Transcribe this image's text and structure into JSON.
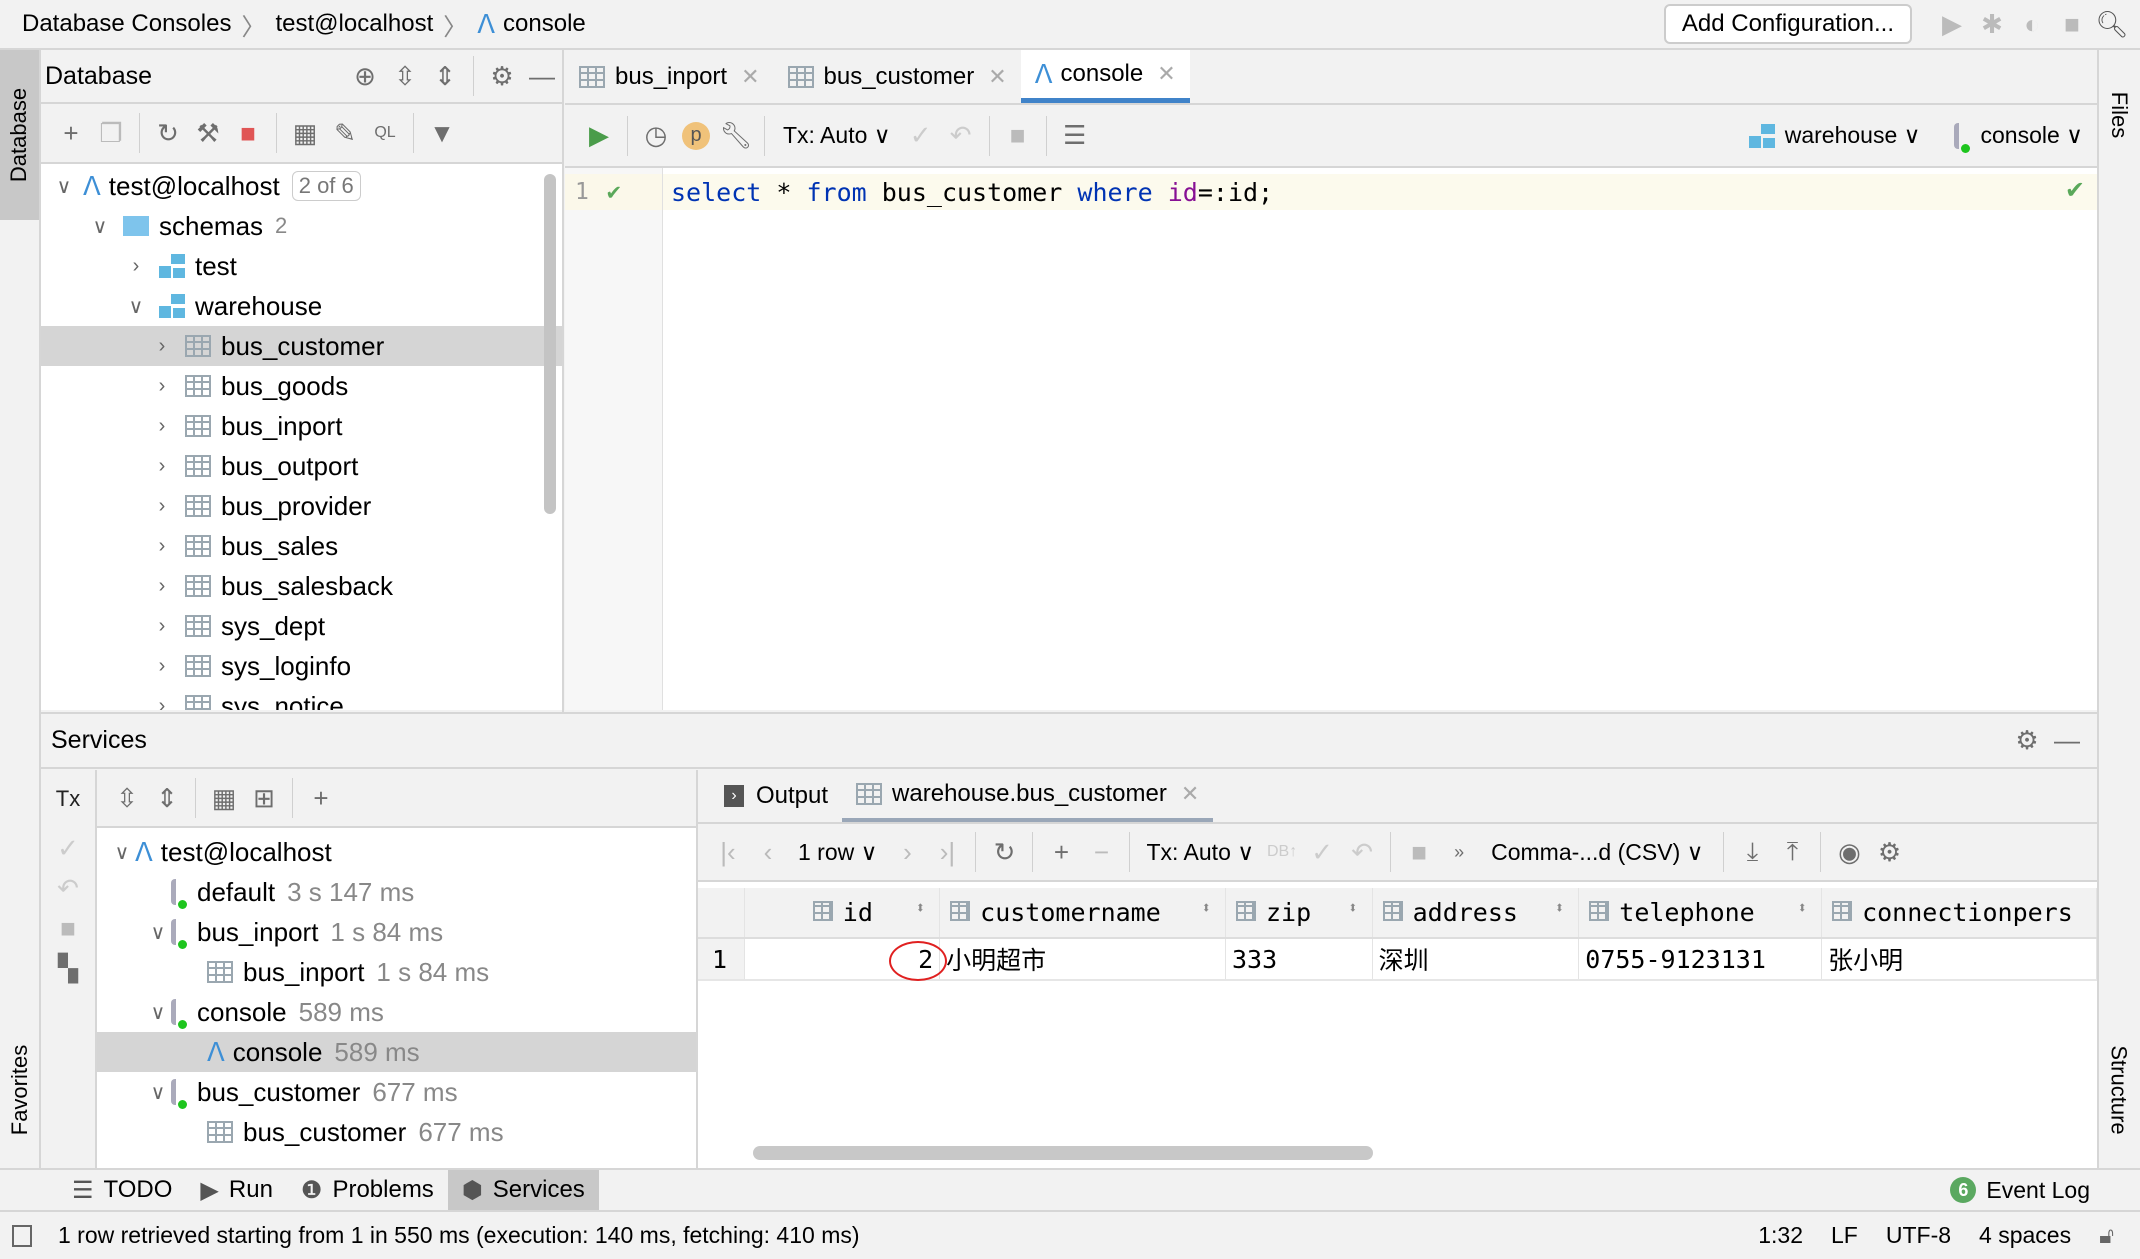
{
  "breadcrumb": [
    "Database Consoles",
    "test@localhost",
    "console"
  ],
  "top": {
    "add_config": "Add Configuration..."
  },
  "left_stripe": {
    "database": "Database",
    "favorites": "Favorites"
  },
  "right_stripe": {
    "files": "Files",
    "structure": "Structure"
  },
  "db_panel": {
    "title": "Database",
    "root": {
      "label": "test@localhost",
      "badge": "2 of 6"
    },
    "schemas": {
      "label": "schemas",
      "count": "2"
    },
    "schema_items": [
      "test",
      "warehouse"
    ],
    "tables": [
      "bus_customer",
      "bus_goods",
      "bus_inport",
      "bus_outport",
      "bus_provider",
      "bus_sales",
      "bus_salesback",
      "sys_dept",
      "sys_loginfo",
      "sys_notice"
    ],
    "selected": "bus_customer"
  },
  "editor": {
    "tabs": [
      {
        "label": "bus_inport"
      },
      {
        "label": "bus_customer"
      },
      {
        "label": "console",
        "active": true
      }
    ],
    "tx": "Tx: Auto",
    "schema": "warehouse",
    "session": "console",
    "line_no": "1",
    "code": [
      {
        "t": "select",
        "c": "kw"
      },
      {
        "t": " * ",
        "c": "pl"
      },
      {
        "t": "from",
        "c": "kw"
      },
      {
        "t": " bus_customer ",
        "c": "pl"
      },
      {
        "t": "where",
        "c": "kw"
      },
      {
        "t": " ",
        "c": "pl"
      },
      {
        "t": "id",
        "c": "col"
      },
      {
        "t": "=:id;",
        "c": "pl"
      }
    ]
  },
  "services": {
    "title": "Services",
    "tx": "Tx",
    "tree": [
      {
        "label": "test@localhost",
        "time": "",
        "level": 0,
        "icon": "mysql",
        "chev": true
      },
      {
        "label": "default",
        "time": "3 s 147 ms",
        "level": 1,
        "icon": "session",
        "chev": false
      },
      {
        "label": "bus_inport",
        "time": "1 s 84 ms",
        "level": 1,
        "icon": "session",
        "chev": true
      },
      {
        "label": "bus_inport",
        "time": "1 s 84 ms",
        "level": 2,
        "icon": "table",
        "chev": false
      },
      {
        "label": "console",
        "time": "589 ms",
        "level": 1,
        "icon": "session",
        "chev": true
      },
      {
        "label": "console",
        "time": "589 ms",
        "level": 2,
        "icon": "mysql",
        "chev": false,
        "selected": true
      },
      {
        "label": "bus_customer",
        "time": "677 ms",
        "level": 1,
        "icon": "session",
        "chev": true
      },
      {
        "label": "bus_customer",
        "time": "677 ms",
        "level": 2,
        "icon": "table",
        "chev": false
      }
    ],
    "tabs": [
      "Output",
      "warehouse.bus_customer"
    ],
    "toolbar": {
      "rows": "1 row",
      "tx": "Tx: Auto",
      "format": "Comma-...d (CSV)"
    },
    "columns": [
      "id",
      "customername",
      "zip",
      "address",
      "telephone",
      "connectionpers"
    ],
    "rows": [
      {
        "n": "1",
        "cells": [
          "2",
          "小明超市",
          "333",
          "深圳",
          "0755-9123131",
          "张小明"
        ]
      }
    ]
  },
  "bottom_tabs": [
    "TODO",
    "Run",
    "Problems",
    "Services"
  ],
  "event_log": {
    "label": "Event Log",
    "count": "6"
  },
  "status": {
    "message": "1 row retrieved starting from 1 in 550 ms (execution: 140 ms, fetching: 410 ms)",
    "pos": "1:32",
    "eol": "LF",
    "enc": "UTF-8",
    "indent": "4 spaces"
  },
  "colors": {
    "accent": "#4083c9",
    "keyword": "#0033b3",
    "column": "#871094",
    "run": "#4a9c4a",
    "stop": "#e05555",
    "highlight_circle": "#e02020"
  }
}
